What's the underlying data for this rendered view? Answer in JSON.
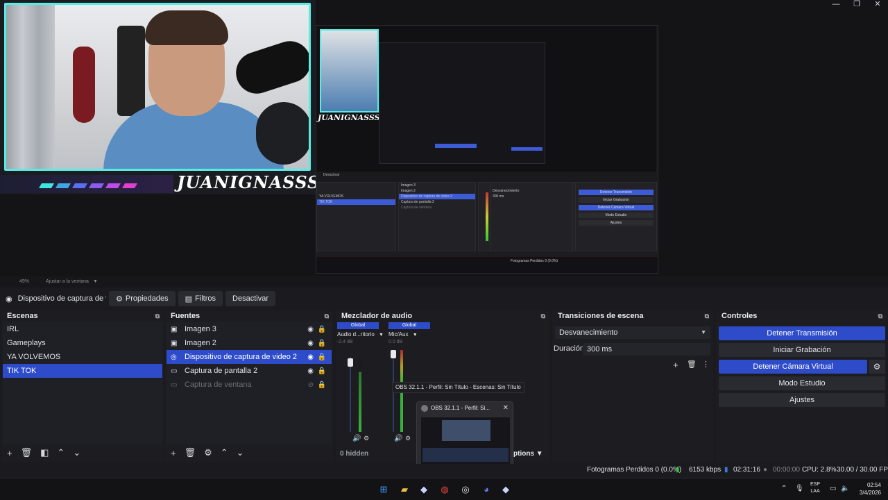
{
  "window": {
    "minimize": "—",
    "maximize": "❐",
    "close": "✕"
  },
  "webcam": {
    "streamer_name": "JUANIGNASSS",
    "mirror_name": "JUANIGNASSS"
  },
  "scale_bar": {
    "zoom": "49%",
    "fit_label": "Ajustar a la ventana"
  },
  "toolbar": {
    "source_label": "Dispositivo de captura de v",
    "props_label": "Propiedades",
    "filters_label": "Filtros",
    "deactivate_label": "Desactivar"
  },
  "scenes": {
    "title": "Escenas",
    "items": [
      "IRL",
      "Gameplays",
      "YA VOLVEMOS",
      "TIK TOK"
    ]
  },
  "sources": {
    "title": "Fuentes",
    "items": [
      "Imagen 3",
      "Imagen 2",
      "Dispositivo de captura de video 2",
      "Captura de pantalla 2",
      "Captura de ventana"
    ]
  },
  "mixer": {
    "title": "Mezclador de audio",
    "channels": [
      {
        "badge": "Global",
        "name": "Audio d...ritorio",
        "db": "-2.4 dB"
      },
      {
        "badge": "Global",
        "name": "Mic/Aux",
        "db": "0.0 dB"
      }
    ],
    "hidden": "0 hidden",
    "options": "ptions"
  },
  "transitions": {
    "title": "Transiciones de escena",
    "type": "Desvanecimiento",
    "duration_label": "Duración",
    "duration_value": "300 ms"
  },
  "controls": {
    "title": "Controles",
    "stop_stream": "Detener Transmisión",
    "start_record": "Iniciar Grabación",
    "stop_vcam": "Detener Cámara Virtual",
    "studio_mode": "Modo Estudio",
    "settings": "Ajustes"
  },
  "tooltip": "OBS 32.1.1 - Perfil: Sin Título - Escenas: Sin Título",
  "popup_title": "OBS 32.1.1 - Perfil: Si...",
  "status": {
    "dropped": "Fotogramas Perdidos 0 (0.0%)",
    "bitrate": "6153 kbps",
    "stream_time": "02:31:16",
    "rec_time": "00:00:00",
    "cpu": "CPU: 2.8%",
    "fps": "30.00 / 30.00 FPS"
  },
  "taskbar": {
    "lang_top": "ESP",
    "lang_bottom": "LAA",
    "time": "02:54",
    "date": "3/4/2026"
  },
  "mini": {
    "deactivate": "Desactivar",
    "scenes": [
      "IRL",
      "Gameplays",
      "YA VOLVEMOS",
      "TIK TOK"
    ],
    "sources": [
      "Imagen 3",
      "Imagen 2",
      "Dispositivo de captura de video 2",
      "Captura de pantalla 2",
      "Captura de ventana"
    ],
    "transition": "Desvanecimiento",
    "duration": "Duración",
    "duration_value": "300 ms",
    "status": "Fotogramas Perdidos 0 (0.0%)",
    "controls": [
      "Detener Transmisión",
      "Iniciar Grabación",
      "Detener Cámara Virtual",
      "Modo Estudio",
      "Ajustes"
    ]
  },
  "colors": {
    "accent": "#2e4cc9",
    "cam_border": "#58ece7"
  }
}
